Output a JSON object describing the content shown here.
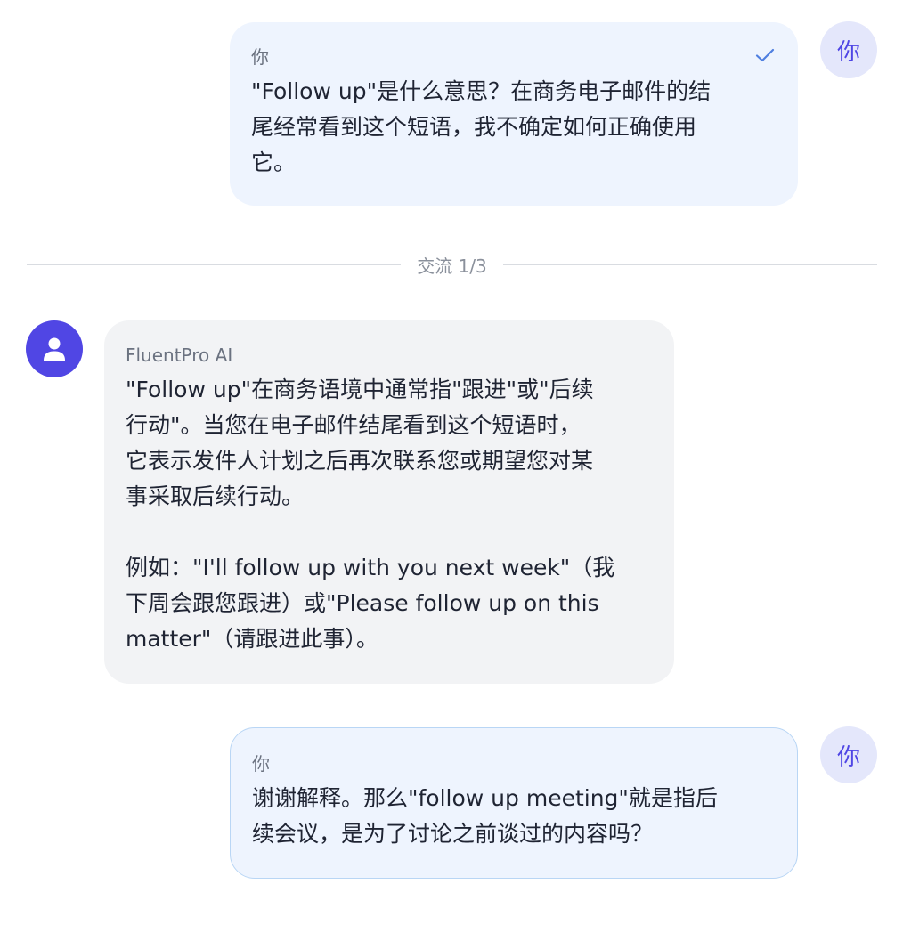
{
  "messages": [
    {
      "sender": "你",
      "avatar": "你",
      "text": "\"Follow up\"是什么意思？在商务电子邮件的结\n尾经常看到这个短语，我不确定如何正确使用\n它。"
    },
    {
      "sender": "FluentPro AI",
      "text": "\"Follow up\"在商务语境中通常指\"跟进\"或\"后续\n行动\"。当您在电子邮件结尾看到这个短语时，\n它表示发件人计划之后再次联系您或期望您对某\n事采取后续行动。\n\n例如：\"I'll follow up with you next week\"（我\n下周会跟您跟进）或\"Please follow up on this\nmatter\"（请跟进此事）。"
    },
    {
      "sender": "你",
      "avatar": "你",
      "text": "谢谢解释。那么\"follow up meeting\"就是指后\n续会议，是为了讨论之前谈过的内容吗？"
    }
  ],
  "divider": {
    "label": "交流 1/3"
  },
  "icons": {
    "sent_status": "checkmark-icon",
    "ai_avatar": "user-silhouette-icon"
  },
  "colors": {
    "accent": "#4f46e5",
    "user_bubble": "#eef4fe",
    "ai_bubble": "#f2f3f5",
    "user_bubble_border": "#b9d6f5"
  }
}
